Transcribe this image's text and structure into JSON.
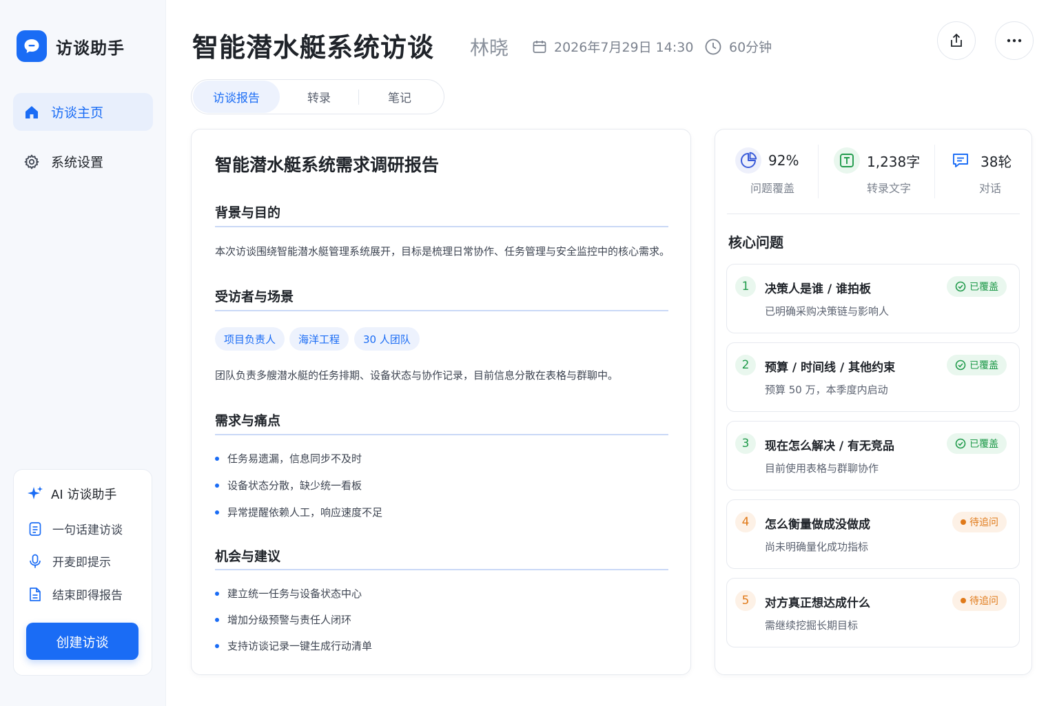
{
  "app": {
    "name": "访谈助手"
  },
  "sidebar": {
    "nav": [
      {
        "label": "访谈主页",
        "icon": "home-icon",
        "active": true
      },
      {
        "label": "系统设置",
        "icon": "gear-icon",
        "active": false
      }
    ],
    "ai_card": {
      "title": "AI 访谈助手",
      "features": [
        {
          "label": "一句话建访谈",
          "icon": "document-list-icon"
        },
        {
          "label": "开麦即提示",
          "icon": "microphone-icon"
        },
        {
          "label": "结束即得报告",
          "icon": "report-icon"
        }
      ],
      "create_label": "创建访谈"
    }
  },
  "header": {
    "title": "智能潜水艇系统访谈",
    "interviewer": "林晓",
    "datetime": "2026年7月29日 14:30",
    "duration": "60分钟"
  },
  "tabs": [
    {
      "label": "访谈报告",
      "active": true
    },
    {
      "label": "转录",
      "active": false
    },
    {
      "label": "笔记",
      "active": false
    }
  ],
  "report": {
    "title": "智能潜水艇系统需求调研报告",
    "background": {
      "heading": "背景与目的",
      "text": "本次访谈围绕智能潜水艇管理系统展开，目标是梳理日常协作、任务管理与安全监控中的核心需求。"
    },
    "interviewee": {
      "heading": "受访者与场景",
      "tags": [
        "项目负责人",
        "海洋工程",
        "30 人团队"
      ],
      "text": "团队负责多艘潜水艇的任务排期、设备状态与协作记录，目前信息分散在表格与群聊中。"
    },
    "pain_points": {
      "heading": "需求与痛点",
      "items": [
        "任务易遗漏，信息同步不及时",
        "设备状态分散，缺少统一看板",
        "异常提醒依赖人工，响应速度不足"
      ]
    },
    "opportunities": {
      "heading": "机会与建议",
      "items": [
        "建立统一任务与设备状态中心",
        "增加分级预警与责任人闭环",
        "支持访谈记录一键生成行动清单"
      ]
    }
  },
  "stats": [
    {
      "value": "92%",
      "label": "问题覆盖",
      "icon": "pie-chart-icon",
      "color": "#3a5bd9"
    },
    {
      "value": "1,238字",
      "label": "转录文字",
      "icon": "text-icon",
      "color": "#1f9a4a"
    },
    {
      "value": "38轮",
      "label": "对话",
      "icon": "chat-icon",
      "color": "#1a6cf5"
    }
  ],
  "core_questions": {
    "title": "核心问题",
    "items": [
      {
        "num": "1",
        "title": "决策人是谁 / 谁拍板",
        "sub": "已明确采购决策链与影响人",
        "status": "已覆盖",
        "state": "ok"
      },
      {
        "num": "2",
        "title": "预算 / 时间线 / 其他约束",
        "sub": "预算 50 万，本季度内启动",
        "status": "已覆盖",
        "state": "ok"
      },
      {
        "num": "3",
        "title": "现在怎么解决 / 有无竞品",
        "sub": "目前使用表格与群聊协作",
        "status": "已覆盖",
        "state": "ok"
      },
      {
        "num": "4",
        "title": "怎么衡量做成没做成",
        "sub": "尚未明确量化成功指标",
        "status": "待追问",
        "state": "pending"
      },
      {
        "num": "5",
        "title": "对方真正想达成什么",
        "sub": "需继续挖掘长期目标",
        "status": "待追问",
        "state": "pending"
      }
    ]
  },
  "colors": {
    "accent": "#1a6cf5",
    "success": "#1f9a4a",
    "warning": "#e07a1a"
  }
}
